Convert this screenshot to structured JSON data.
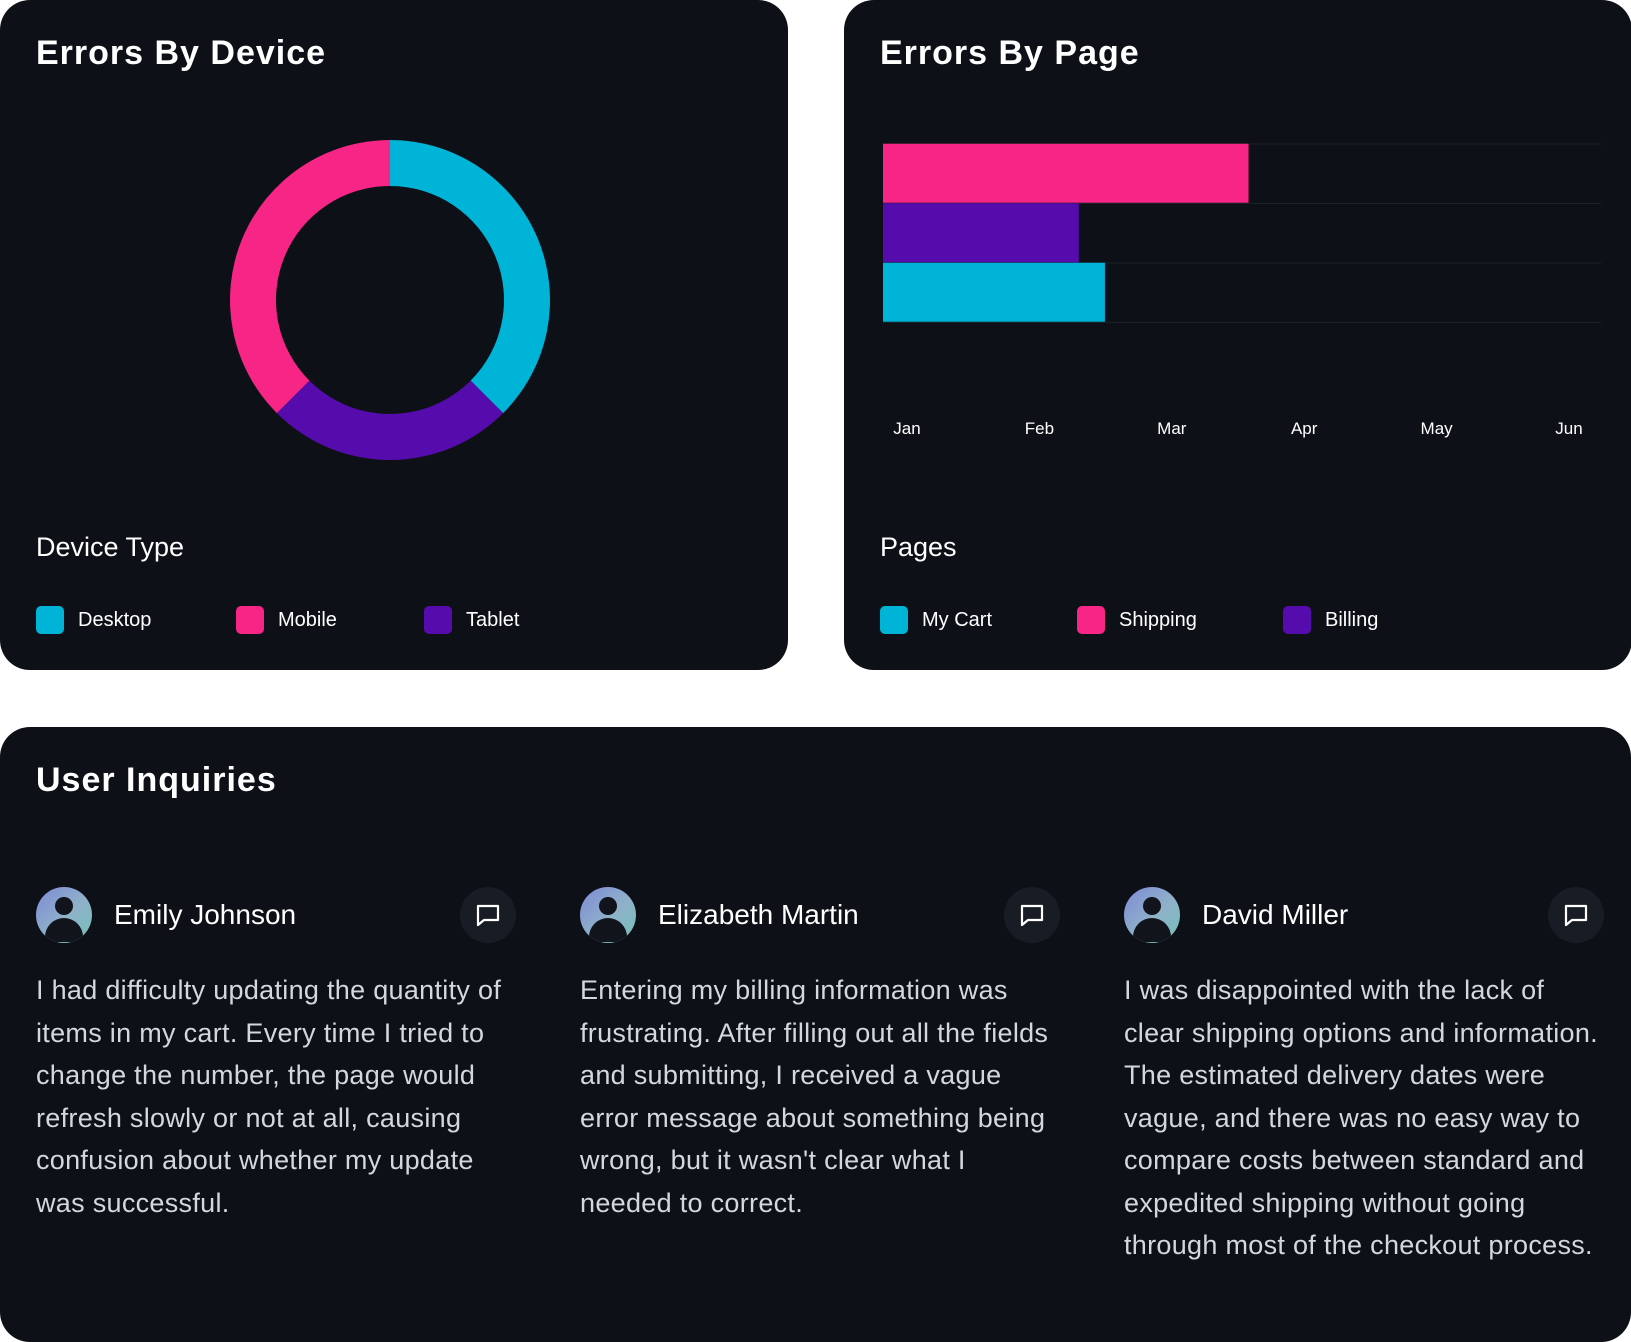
{
  "device_card": {
    "title": "Errors By Device",
    "legend_title": "Device Type",
    "legend": [
      {
        "label": "Desktop",
        "color": "#00b4d8"
      },
      {
        "label": "Mobile",
        "color": "#f72585"
      },
      {
        "label": "Tablet",
        "color": "#560bad"
      }
    ]
  },
  "page_card": {
    "title": "Errors By Page",
    "legend_title": "Pages",
    "legend": [
      {
        "label": "My Cart",
        "color": "#00b4d8"
      },
      {
        "label": "Shipping",
        "color": "#f72585"
      },
      {
        "label": "Billing",
        "color": "#560bad"
      }
    ]
  },
  "inquiries_card": {
    "title": "User Inquiries",
    "items": [
      {
        "name": "Emily Johnson",
        "text": "I had difficulty updating the quantity of items in my cart. Every time I tried to change the number, the page would refresh slowly or not at all, causing confusion about whether my update was successful."
      },
      {
        "name": "Elizabeth Martin",
        "text": "Entering my billing information was frustrating. After filling out all the fields and submitting, I received a vague error message about something being wrong, but it wasn't clear what I needed to correct."
      },
      {
        "name": "David Miller",
        "text": "I was disappointed with the lack of clear shipping options and information. The estimated delivery dates were vague, and there was no easy way to compare costs between standard and expedited shipping without going through most of the checkout process."
      }
    ]
  },
  "chart_data": [
    {
      "type": "pie",
      "variant": "donut",
      "title": "Errors By Device",
      "categories": [
        "Desktop",
        "Tablet",
        "Mobile"
      ],
      "values": [
        37.5,
        25,
        37.5
      ],
      "colors": [
        "#00b4d8",
        "#560bad",
        "#f72585"
      ],
      "legend": "bottom-left"
    },
    {
      "type": "bar",
      "orientation": "horizontal",
      "title": "Errors By Page",
      "categories": [
        "Shipping",
        "Billing",
        "My Cart"
      ],
      "values": [
        2.8,
        1.5,
        1.7
      ],
      "colors": [
        "#f72585",
        "#560bad",
        "#00b4d8"
      ],
      "x_tick_labels": [
        "Jan",
        "Feb",
        "Mar",
        "Apr",
        "May",
        "Jun"
      ],
      "xlim": [
        0,
        5.5
      ],
      "grid": true,
      "legend": "bottom-left"
    }
  ]
}
